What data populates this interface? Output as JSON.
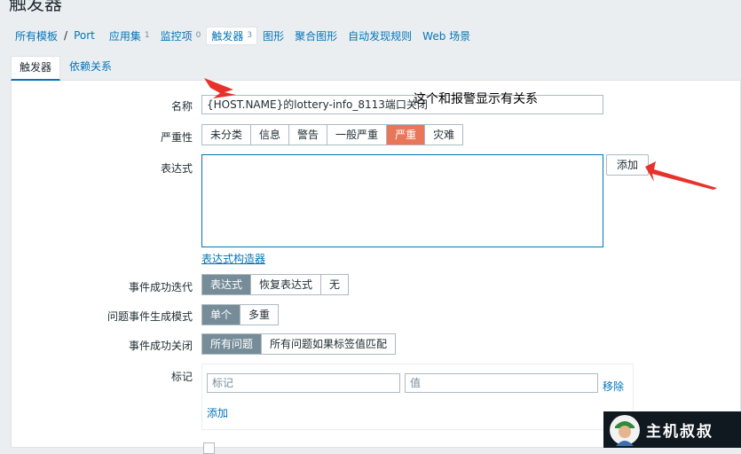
{
  "page_title": "触发器",
  "breadcrumb": {
    "all_templates": "所有模板",
    "separator": "/",
    "host": "Port",
    "items": [
      {
        "label": "应用集",
        "count": "1"
      },
      {
        "label": "监控项",
        "count": "0"
      },
      {
        "label": "触发器",
        "count": "3"
      },
      {
        "label": "图形",
        "count": ""
      },
      {
        "label": "聚合图形",
        "count": ""
      },
      {
        "label": "自动发现规则",
        "count": ""
      },
      {
        "label": "Web 场景",
        "count": ""
      }
    ]
  },
  "tabs": {
    "trigger": "触发器",
    "dependencies": "依赖关系"
  },
  "form": {
    "name_label": "名称",
    "name_value": "{HOST.NAME}的lottery-info_8113端口关闭",
    "severity_label": "严重性",
    "severity_options": [
      "未分类",
      "信息",
      "警告",
      "一般严重",
      "严重",
      "灾难"
    ],
    "expression_label": "表达式",
    "add_button": "添加",
    "expression_builder": "表达式构造器",
    "ok_event_gen_label": "事件成功迭代",
    "ok_event_gen_options": [
      "表达式",
      "恢复表达式",
      "无"
    ],
    "problem_mode_label": "问题事件生成模式",
    "problem_mode_options": [
      "单个",
      "多重"
    ],
    "ok_close_label": "事件成功关闭",
    "ok_close_options": [
      "所有问题",
      "所有问题如果标签值匹配"
    ],
    "tags_label": "标记",
    "tag_placeholder": "标记",
    "value_placeholder": "值",
    "remove_link": "移除",
    "add_link": "添加"
  },
  "annotation_text": "这个和报警显示有关系",
  "watermark_text": "主机叔叔",
  "colors": {
    "link": "#0275b8",
    "selected": "#768d99",
    "severity_high": "#e97659",
    "arrow": "#e8312a"
  }
}
